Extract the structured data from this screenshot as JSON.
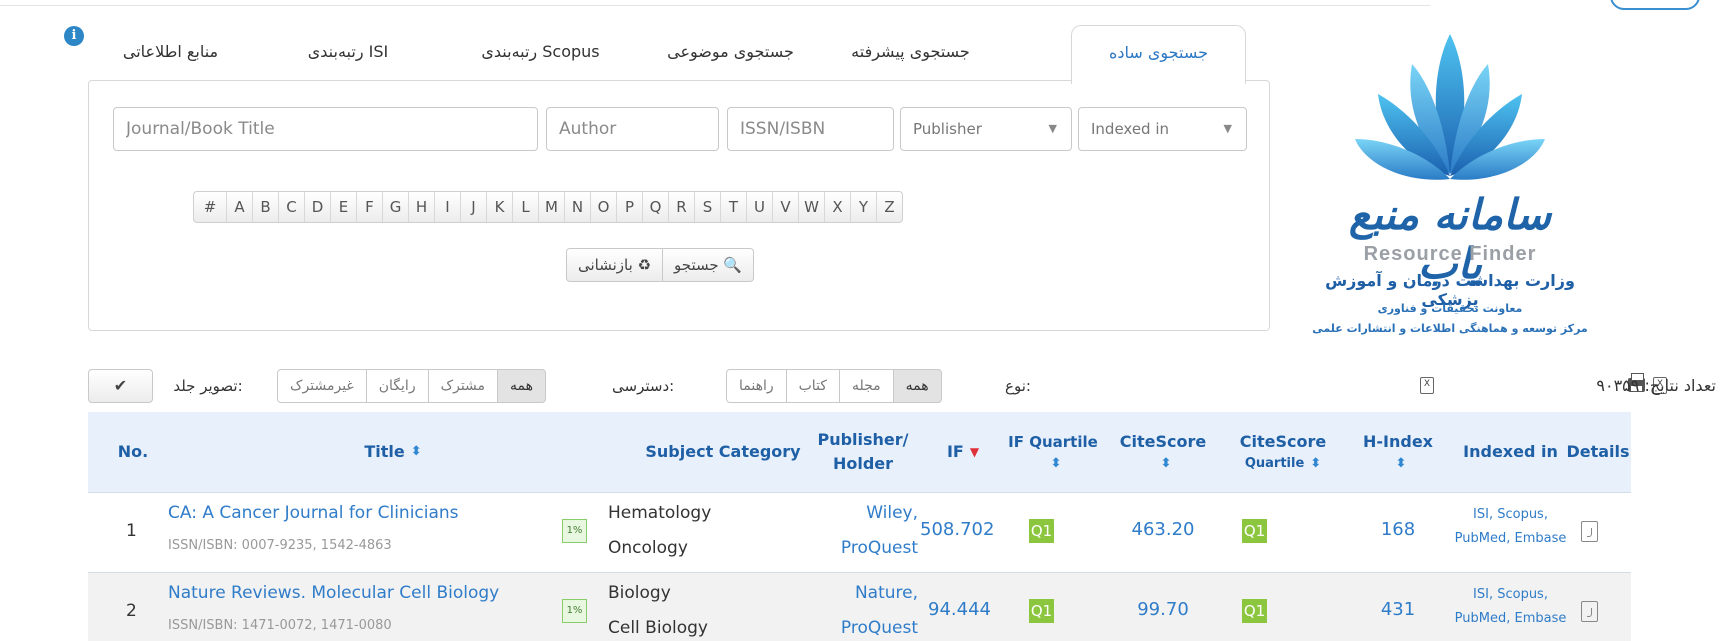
{
  "tabs": [
    "منابع اطلاعاتی",
    "رتبه‌بندی ISI",
    "رتبه‌بندی Scopus",
    "جستجوی موضوعی",
    "جستجوی پیشرفته",
    "جستجوی ساده"
  ],
  "active_tab": "جستجوی ساده",
  "search": {
    "title_placeholder": "Journal/Book Title",
    "author_placeholder": "Author",
    "issn_placeholder": "ISSN/ISBN",
    "publisher_select": "Publisher",
    "indexed_select": "Indexed in"
  },
  "alphabet": [
    "#",
    "A",
    "B",
    "C",
    "D",
    "E",
    "F",
    "G",
    "H",
    "I",
    "J",
    "K",
    "L",
    "M",
    "N",
    "O",
    "P",
    "Q",
    "R",
    "S",
    "T",
    "U",
    "V",
    "W",
    "X",
    "Y",
    "Z"
  ],
  "buttons": {
    "reset": "بازنشانی ♻",
    "search": "جستجو 🔍"
  },
  "logo": {
    "fa": "سامانه منبع یاب",
    "en": "Resource Finder",
    "line1": "وزارت بهداشت درمان و آموزش پزشکی",
    "line2": "معاونت تحقیقات و فناوری",
    "line3": "مرکز توسعه و هماهنگی اطلاعات و انتشارات علمی"
  },
  "filters": {
    "cover_label": "تصویر جلد:",
    "cover_check": "✔",
    "access_label": "دسترسی:",
    "access_options": [
      "غیرمشترک",
      "رایگان",
      "مشترک",
      "همه"
    ],
    "type_label": "نوع:",
    "type_options": [
      "راهنما",
      "کتاب",
      "مجله",
      "همه"
    ],
    "count_text": "تعداد نتایج: ۹۰۳۵۹"
  },
  "columns": {
    "no": "No.",
    "title": "Title",
    "subject": "Subject Category",
    "publisher_l1": "Publisher/",
    "publisher_l2": "Holder",
    "if": "IF",
    "if_quartile": "IF Quartile",
    "citescore": "CiteScore",
    "cs_quartile_l1": "CiteScore",
    "cs_quartile_l2": "Quartile",
    "hindex": "H-Index",
    "indexed": "Indexed in",
    "details": "Details"
  },
  "rows": [
    {
      "no": "1",
      "title": "CA: A Cancer Journal for Clinicians",
      "issn": "ISSN/ISBN: 0007-9235, 1542-4863",
      "pct": "1%",
      "subject1": "Hematology",
      "subject2": "Oncology",
      "pub1": "Wiley,",
      "pub2": "ProQuest",
      "if": "508.702",
      "ifq": "Q1",
      "citescore": "463.20",
      "csq": "Q1",
      "hindex": "168",
      "idx1": "ISI, Scopus,",
      "idx2": "PubMed, Embase"
    },
    {
      "no": "2",
      "title": "Nature Reviews. Molecular Cell Biology",
      "issn": "ISSN/ISBN: 1471-0072, 1471-0080",
      "pct": "1%",
      "subject1": "Biology",
      "subject2": "Cell Biology",
      "pub1": "Nature,",
      "pub2": "ProQuest",
      "if": "94.444",
      "ifq": "Q1",
      "citescore": "99.70",
      "csq": "Q1",
      "hindex": "431",
      "idx1": "ISI, Scopus,",
      "idx2": "PubMed, Embase"
    }
  ]
}
